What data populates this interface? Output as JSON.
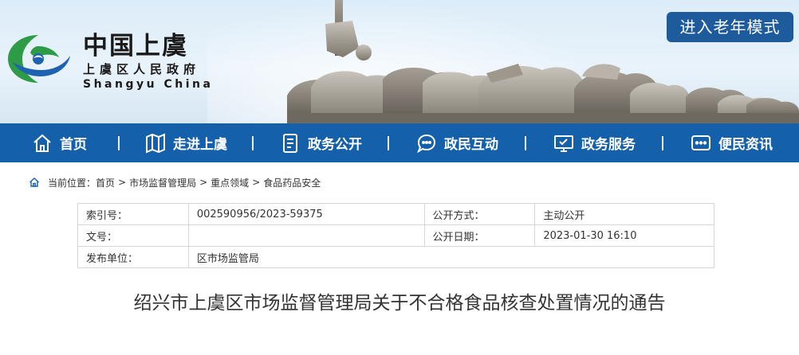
{
  "header": {
    "logo_title": "中国上虞",
    "logo_subtitle": "上虞区人民政府",
    "logo_english": "Shangyu China",
    "elder_mode_button": "进入老年模式"
  },
  "nav": {
    "items": [
      {
        "label": "首页",
        "icon": "home-icon"
      },
      {
        "label": "走进上虞",
        "icon": "map-icon"
      },
      {
        "label": "政务公开",
        "icon": "document-icon"
      },
      {
        "label": "政民互动",
        "icon": "chat-icon"
      },
      {
        "label": "政务服务",
        "icon": "monitor-icon"
      },
      {
        "label": "便民资讯",
        "icon": "message-icon"
      }
    ]
  },
  "breadcrumb": {
    "prefix": "当前位置：",
    "items": [
      "首页",
      "市场监督管理局",
      "重点领域",
      "食品药品安全"
    ],
    "separator": ">"
  },
  "info": {
    "index_label": "索引号：",
    "index_value": "002590956/2023-59375",
    "disclosure_label": "公开方式：",
    "disclosure_value": "主动公开",
    "doc_no_label": "文号：",
    "doc_no_value": "",
    "date_label": "公开日期：",
    "date_value": "2023-01-30 16:10",
    "publisher_label": "发布单位：",
    "publisher_value": "区市场监管局"
  },
  "article": {
    "title": "绍兴市上虞区市场监督管理局关于不合格食品核查处置情况的通告"
  },
  "colors": {
    "nav_bg": "#1560ab",
    "elder_button_bg": "#1d5b9c",
    "logo_green": "#2e9b46",
    "logo_blue": "#1f63b0"
  }
}
